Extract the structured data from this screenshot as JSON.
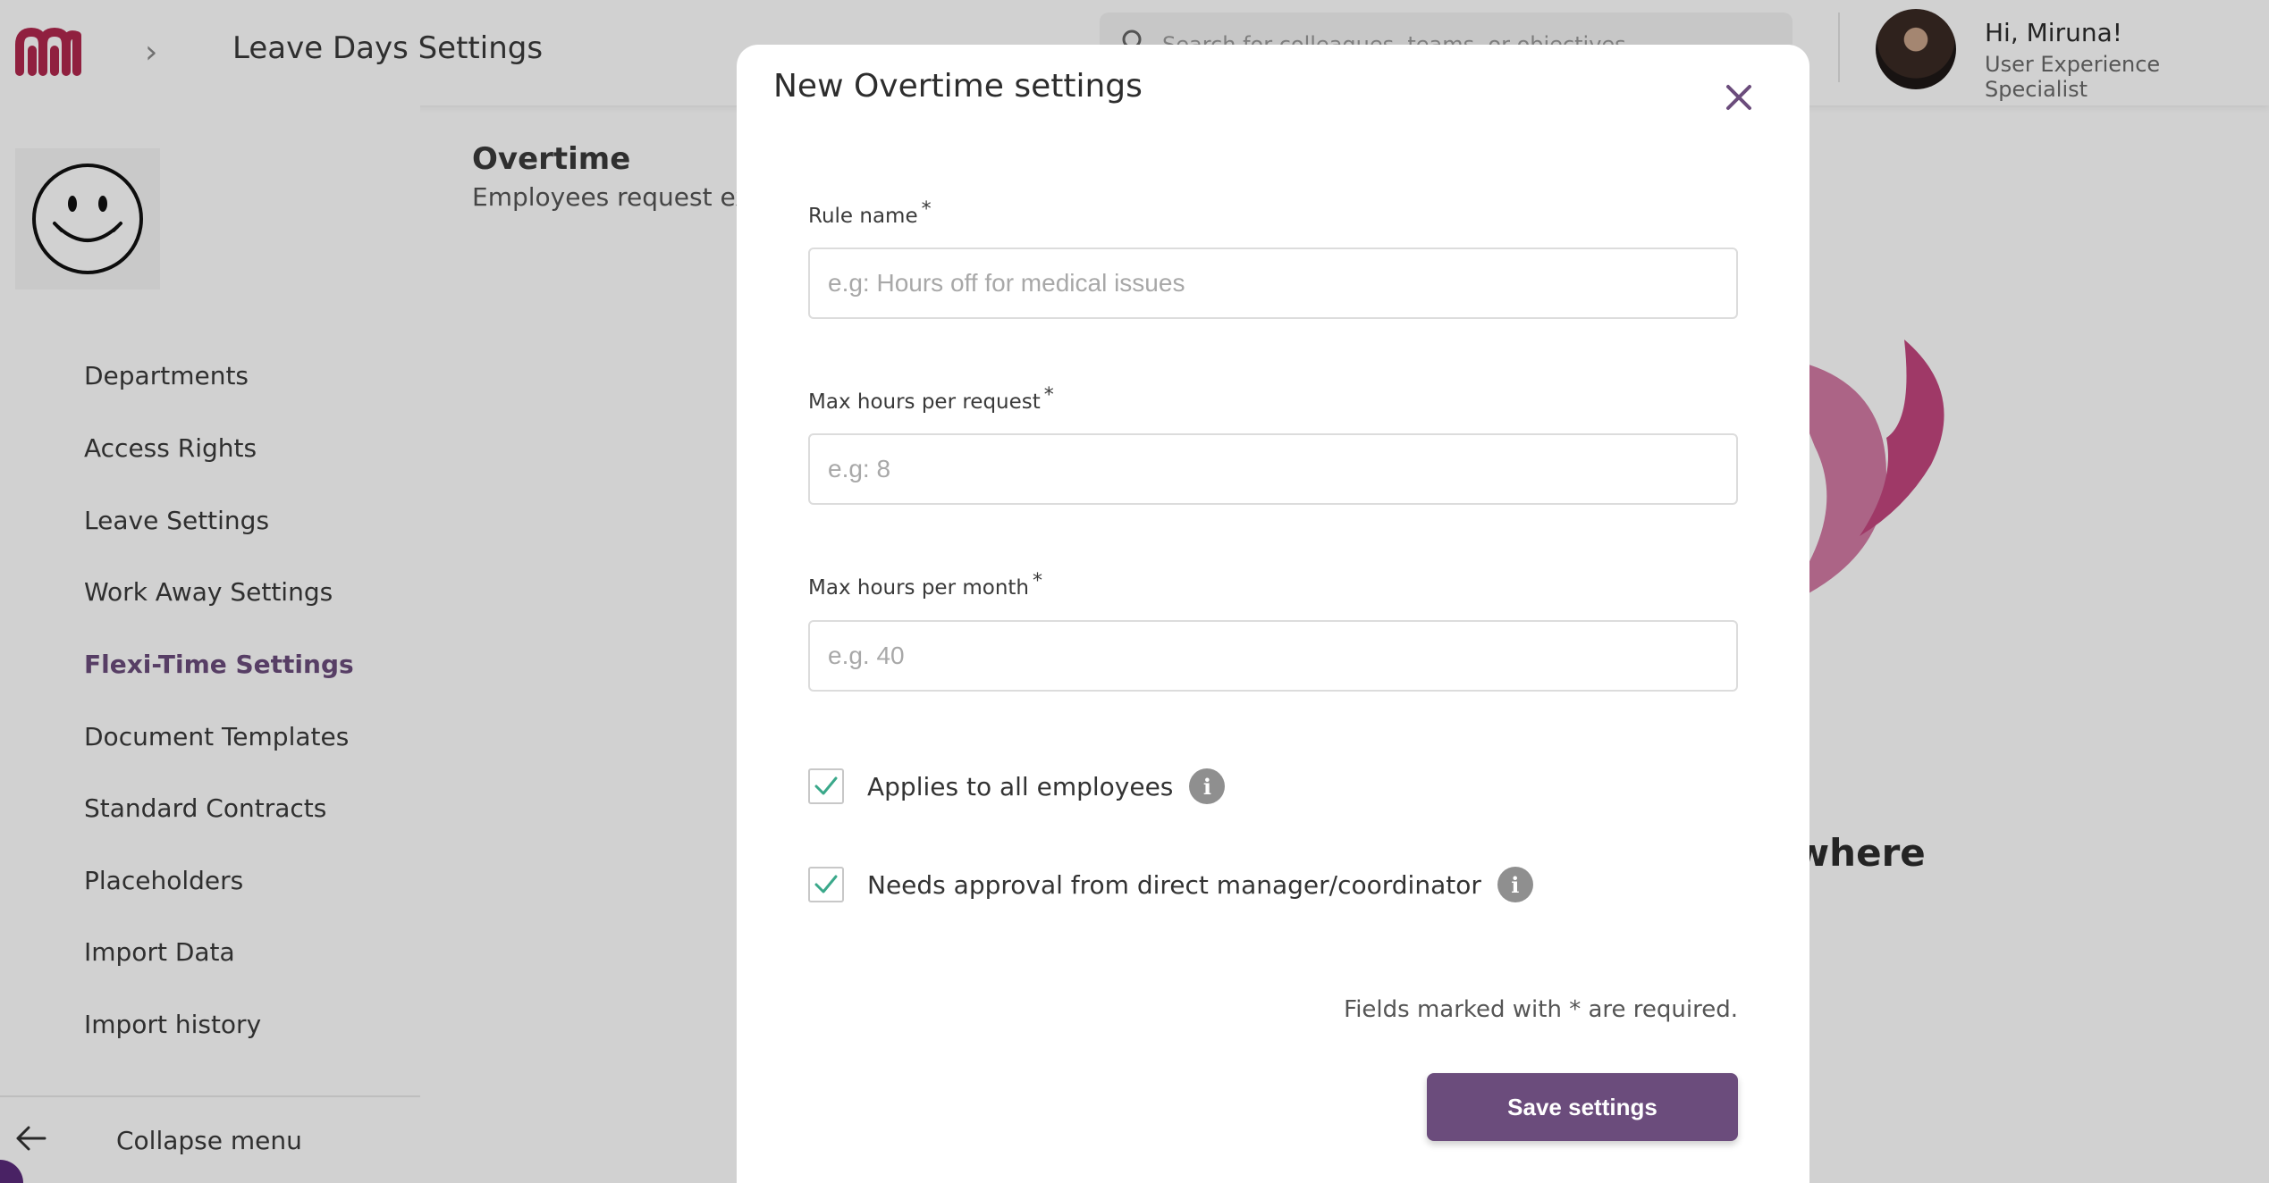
{
  "header": {
    "page_title": "Leave Days Settings",
    "search_placeholder": "Search for colleagues, teams, or objectives",
    "greeting": "Hi, Miruna!",
    "role": "User Experience Specialist"
  },
  "sidebar": {
    "items": [
      {
        "label": "Departments",
        "active": false
      },
      {
        "label": "Access Rights",
        "active": false
      },
      {
        "label": "Leave Settings",
        "active": false
      },
      {
        "label": "Work Away Settings",
        "active": false
      },
      {
        "label": "Flexi-Time Settings",
        "active": true
      },
      {
        "label": "Document Templates",
        "active": false
      },
      {
        "label": "Standard Contracts",
        "active": false
      },
      {
        "label": "Placeholders",
        "active": false
      },
      {
        "label": "Import Data",
        "active": false
      },
      {
        "label": "Import history",
        "active": false
      }
    ],
    "collapse_label": "Collapse menu"
  },
  "content": {
    "title": "Overtime",
    "subtitle": "Employees request ext",
    "background_text": "ywhere"
  },
  "modal": {
    "title": "New Overtime settings",
    "fields": [
      {
        "label": "Rule name",
        "required_mark": "*",
        "placeholder": "e.g: Hours off for medical issues",
        "value": ""
      },
      {
        "label": "Max hours per request",
        "required_mark": "*",
        "placeholder": "e.g: 8",
        "value": ""
      },
      {
        "label": "Max hours per month",
        "required_mark": "*",
        "placeholder": "e.g. 40",
        "value": ""
      }
    ],
    "checkboxes": [
      {
        "label": "Applies to all employees",
        "checked": true
      },
      {
        "label": "Needs approval from direct manager/coordinator",
        "checked": true
      }
    ],
    "required_note": "Fields marked with * are required.",
    "save_label": "Save settings"
  },
  "colors": {
    "accent": "#6b4c7c",
    "logo": "#b0284e",
    "check": "#3aa88a",
    "illustration": "#c2467e"
  },
  "icons": {
    "close": "close-icon",
    "info": "info-icon",
    "checkbox_checked": "check-icon",
    "breadcrumb": "chevron-right-icon",
    "collapse": "arrow-left-icon",
    "search": "search-icon"
  }
}
